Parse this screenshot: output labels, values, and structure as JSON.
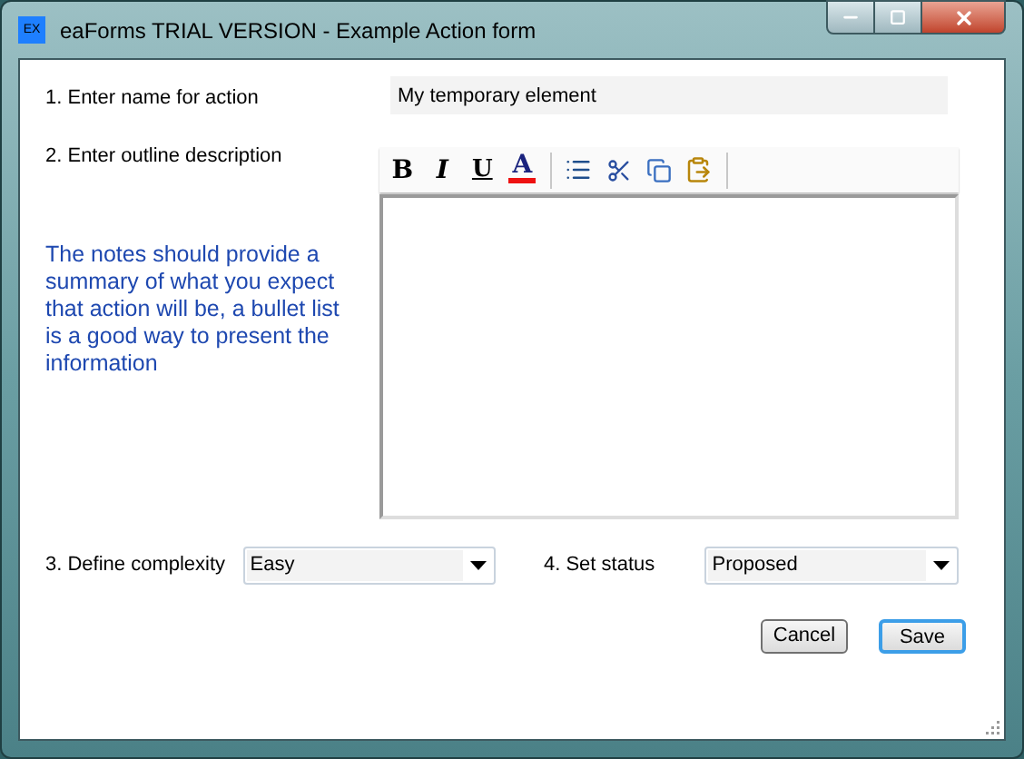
{
  "window": {
    "title": "eaForms TRIAL VERSION - Example Action form",
    "app_badge": "EX"
  },
  "name_row": {
    "label": "1. Enter name for action",
    "value": "My temporary element"
  },
  "description": {
    "label": "2. Enter outline description",
    "notes": "The notes should provide a summary of what you expect that action will be, a bullet list is a good way to present the information",
    "toolbar": [
      {
        "kind": "bold",
        "label": "B"
      },
      {
        "kind": "italic",
        "label": "I"
      },
      {
        "kind": "underline",
        "label": "U"
      },
      {
        "kind": "color",
        "label": "A"
      },
      {
        "kind": "separator"
      },
      {
        "kind": "list"
      },
      {
        "kind": "cut"
      },
      {
        "kind": "copy"
      },
      {
        "kind": "paste"
      },
      {
        "kind": "separator"
      }
    ]
  },
  "complexity": {
    "label": "3. Define complexity",
    "value": "Easy"
  },
  "status": {
    "label": "4. Set status",
    "value": "Proposed"
  },
  "buttons": [
    {
      "label": "Cancel",
      "selected": false
    },
    {
      "label": "Save",
      "selected": true
    }
  ]
}
